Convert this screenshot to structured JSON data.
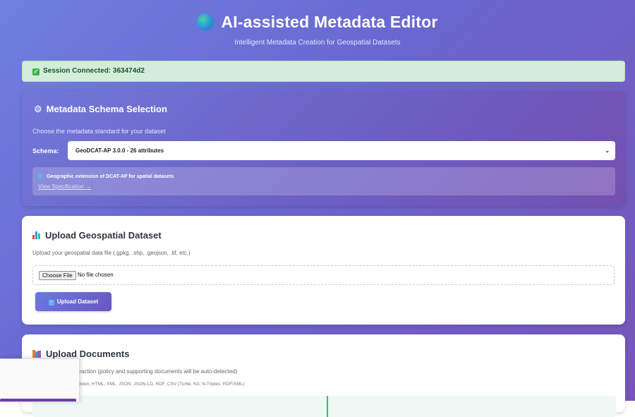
{
  "header": {
    "title": "AI-assisted Metadata Editor",
    "subtitle": "Intelligent Metadata Creation for Geospatial Datasets",
    "icon": "globe-icon"
  },
  "session": {
    "text": "Session Connected: 363474d2",
    "status_color": "#155724"
  },
  "schema": {
    "title": "Metadata Schema Selection",
    "description": "Choose the metadata standard for your dataset",
    "label": "Schema:",
    "selected": "GeoDCAT-AP 3.0.0 - 26 attributes",
    "info": "Geographic extension of DCAT-AP for spatial datasets",
    "link": "View Specification →"
  },
  "upload_dataset": {
    "title": "Upload Geospatial Dataset",
    "description": "Upload your geospatial data file (.gpkg, .shp, .geojson, .tif, etc.)",
    "choose_file": "Choose File",
    "file_status": "No file chosen",
    "button": "Upload Dataset"
  },
  "upload_documents": {
    "title": "Upload Documents",
    "description": "ts for metadata extraction (policy and supporting documents will be auto-detected)",
    "formats": "PDF, Word, Text, Markdown, HTML, XML, JSON, JSON-LD, RDF, CSV (Turtle, N3, N-Triples, RDF/XML)"
  },
  "colors": {
    "accent": "#6a66cf",
    "success_bg": "#d4eddb"
  }
}
